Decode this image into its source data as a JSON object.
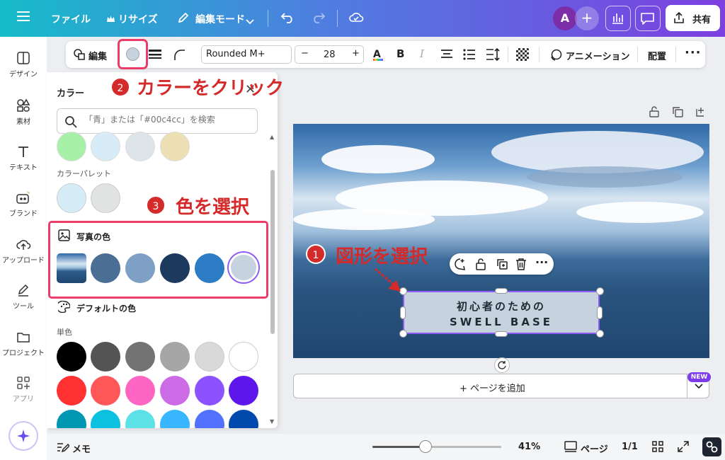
{
  "topbar": {
    "file": "ファイル",
    "resize": "リサイズ",
    "edit_mode": "編集モード",
    "avatar_letter": "A",
    "share": "共有"
  },
  "rail": {
    "items": [
      {
        "label": "デザイン",
        "icon": "layout-icon"
      },
      {
        "label": "素材",
        "icon": "shapes-icon"
      },
      {
        "label": "テキスト",
        "icon": "text-icon"
      },
      {
        "label": "ブランド",
        "icon": "brand-icon"
      },
      {
        "label": "アップロード",
        "icon": "upload-cloud-icon"
      },
      {
        "label": "ツール",
        "icon": "pen-tool-icon"
      },
      {
        "label": "プロジェクト",
        "icon": "folder-icon"
      },
      {
        "label": "アプリ",
        "icon": "apps-icon"
      }
    ]
  },
  "toolbar": {
    "edit": "編集",
    "font": "Rounded M+",
    "font_size": "28",
    "animation": "アニメーション",
    "arrange": "配置"
  },
  "panel": {
    "title": "カラー",
    "search_placeholder": "「青」または「#00c4cc」を検索",
    "palette_label": "カラーパレット",
    "photo_colors_label": "写真の色",
    "default_colors_label": "デフォルトの色",
    "solid_label": "単色",
    "top_row_colors": [
      "#a6f0a8",
      "#d7ecf6",
      "#dde4ea",
      "#ebdfb3"
    ],
    "palette_colors": [
      "#d6edf8",
      "#e0e3e1"
    ],
    "photo_colors": [
      "#4b6e95",
      "#7ea0c4",
      "#1b3a5e",
      "#2b7cc5",
      "#c6d3df"
    ],
    "solid_rows": [
      [
        "#000000",
        "#545454",
        "#737373",
        "#a6a6a6",
        "#d9d9d9",
        "#ffffff"
      ],
      [
        "#ff3131",
        "#ff5757",
        "#ff66c4",
        "#cb6ce6",
        "#8c52ff",
        "#5e17eb"
      ],
      [
        "#0097b2",
        "#0cc0df",
        "#5ce1e6",
        "#38b6ff",
        "#5271ff",
        "#004aad"
      ]
    ]
  },
  "canvas": {
    "shape_line1": "初心者のための",
    "shape_line2": "SWELL BASE",
    "add_page": "+ ページを追加",
    "new_badge": "NEW"
  },
  "annotations": {
    "step1_num": "1",
    "step1_text": "図形を選択",
    "step2_num": "2",
    "step2_text": "カラーをクリック",
    "step3_num": "3",
    "step3_text": "色を選択",
    "color": "#d42a2a"
  },
  "bottombar": {
    "memo": "メモ",
    "zoom": "41%",
    "zoom_fraction": 0.41,
    "pages": "ページ",
    "page_count": "1/1"
  }
}
